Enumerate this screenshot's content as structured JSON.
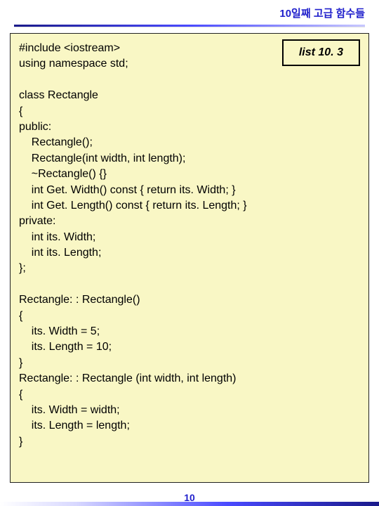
{
  "header": {
    "title": "10일째 고급 함수들"
  },
  "listbox": {
    "label": "list 10. 3"
  },
  "code": {
    "text": "#include <iostream>\nusing namespace std;\n\nclass Rectangle\n{\npublic:\n    Rectangle();\n    Rectangle(int width, int length);\n    ~Rectangle() {}\n    int Get. Width() const { return its. Width; }\n    int Get. Length() const { return its. Length; }\nprivate:\n    int its. Width;\n    int its. Length;\n};\n\nRectangle: : Rectangle()\n{\n    its. Width = 5;\n    its. Length = 10;\n}\nRectangle: : Rectangle (int width, int length)\n{\n    its. Width = width;\n    its. Length = length;\n}"
  },
  "page": {
    "number": "10"
  }
}
